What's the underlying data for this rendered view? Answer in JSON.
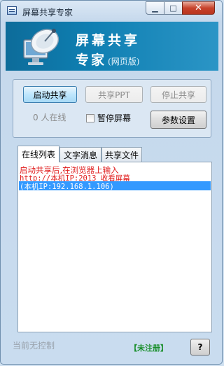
{
  "window": {
    "title": "屏幕共享专家",
    "min_symbol": "▁",
    "max_symbol": "□",
    "close_symbol": "✕"
  },
  "banner": {
    "title": "屏幕共享",
    "subtitle": "专家",
    "edition": "(网页版)"
  },
  "controls": {
    "start_share": "启动共享",
    "share_ppt": "共享PPT",
    "stop_share": "停止共享",
    "online_count_text": "0  人在线",
    "pause_screen_label": "暂停屏幕",
    "pause_screen_checked": false,
    "settings": "参数设置"
  },
  "tabs": [
    {
      "label": "在线列表",
      "active": true
    },
    {
      "label": "文字消息",
      "active": false
    },
    {
      "label": "共享文件",
      "active": false
    }
  ],
  "list": {
    "lines": [
      "启动共享后,在浏览器上输入",
      "http://本机IP:2013 收看屏幕",
      "(本机IP:192.168.1.106)"
    ],
    "selected_index": 2
  },
  "footer": {
    "status": "当前无控制",
    "unregistered": "【未注册】",
    "help": "?"
  },
  "colors": {
    "accent_blue": "#3399ff",
    "notice_red": "#e01c1c",
    "unregistered_green": "#1a8f2c"
  }
}
